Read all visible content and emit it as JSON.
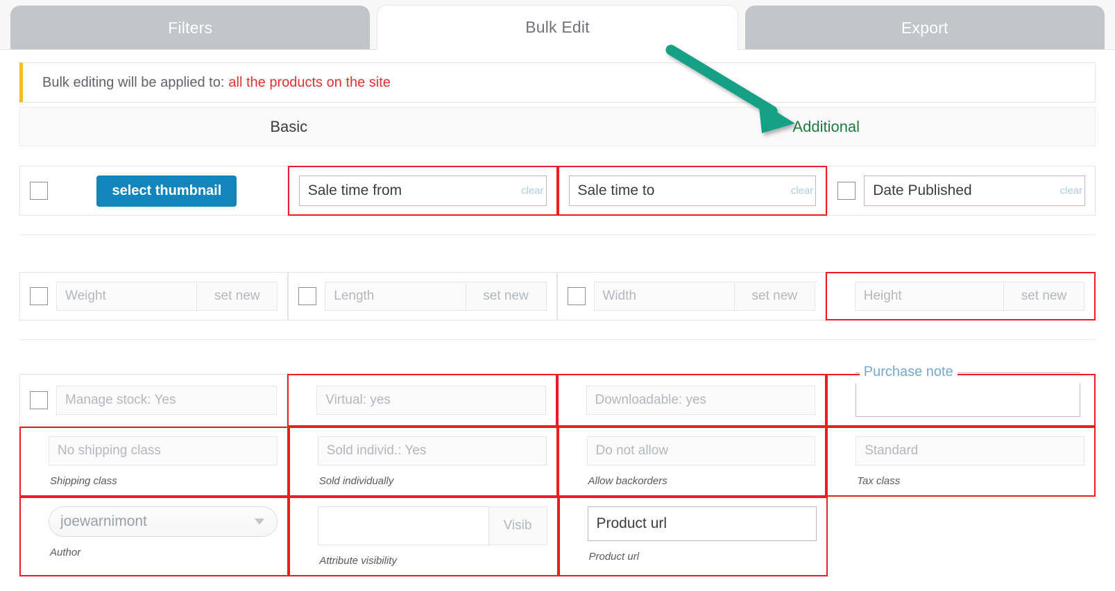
{
  "tabs": [
    {
      "label": "Filters",
      "active": false
    },
    {
      "label": "Bulk Edit",
      "active": true
    },
    {
      "label": "Export",
      "active": false
    }
  ],
  "notice": {
    "prefix": "Bulk editing will be applied to:",
    "target": "all the products on the site"
  },
  "subtabs": {
    "basic": "Basic",
    "additional": "Additional"
  },
  "row1": {
    "thumbnail_button": "select thumbnail",
    "sale_time_from": {
      "placeholder": "Sale time from",
      "clear": "clear"
    },
    "sale_time_to": {
      "placeholder": "Sale time to",
      "clear": "clear"
    },
    "date_published": {
      "placeholder": "Date Published",
      "clear": "clear"
    }
  },
  "row2": {
    "weight": {
      "placeholder": "Weight",
      "addon": "set new"
    },
    "length": {
      "placeholder": "Length",
      "addon": "set new"
    },
    "width": {
      "placeholder": "Width",
      "addon": "set new"
    },
    "height": {
      "placeholder": "Height",
      "addon": "set new"
    }
  },
  "row3": {
    "manage_stock": {
      "placeholder": "Manage stock: Yes"
    },
    "virtual": {
      "placeholder": "Virtual: yes"
    },
    "downloadable": {
      "placeholder": "Downloadable: yes"
    },
    "purchase_note": {
      "legend": "Purchase note",
      "value": ""
    }
  },
  "row4": {
    "shipping_class": {
      "placeholder": "No shipping class",
      "caption": "Shipping class"
    },
    "sold_individually": {
      "placeholder": "Sold individ.: Yes",
      "caption": "Sold individually"
    },
    "allow_backorders": {
      "placeholder": "Do not allow",
      "caption": "Allow backorders"
    },
    "tax_class": {
      "placeholder": "Standard",
      "caption": "Tax class"
    }
  },
  "row5": {
    "author": {
      "value": "joewarnimont",
      "caption": "Author"
    },
    "attribute_visibility": {
      "value": "",
      "addon": "Visib",
      "caption": "Attribute visibility"
    },
    "product_url": {
      "placeholder": "Product url",
      "caption": "Product url"
    }
  },
  "icons": {
    "checkbox": "checkbox-icon",
    "caret": "chevron-down-icon",
    "annotation": "green-arrow-annotation"
  },
  "colors": {
    "accent_blue": "#1385bd",
    "highlight_red": "#ec1c24",
    "notice_red": "#e03131",
    "notice_bar": "#f5bd20",
    "additional_green": "#1f7a41",
    "arrow_green": "#16a085",
    "tab_inactive": "#c2c6cb"
  }
}
